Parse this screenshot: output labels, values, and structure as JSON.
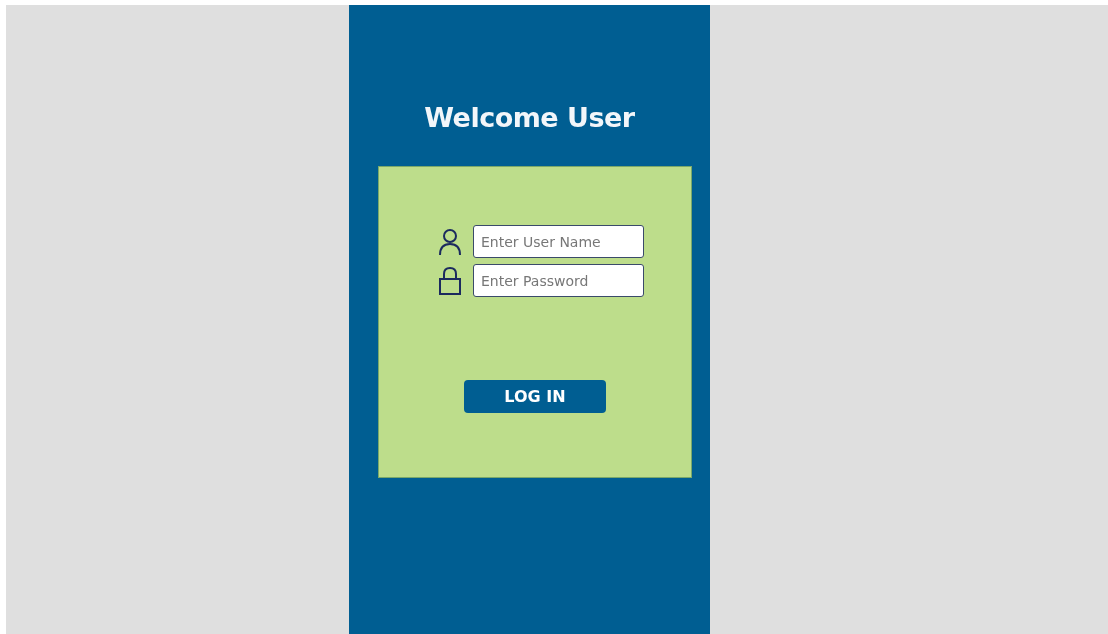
{
  "title": "Welcome User",
  "fields": [
    {
      "kind": "user",
      "placeholder": "Enter User Name"
    },
    {
      "kind": "password",
      "placeholder": "Enter Password"
    }
  ],
  "button": "LOG IN"
}
